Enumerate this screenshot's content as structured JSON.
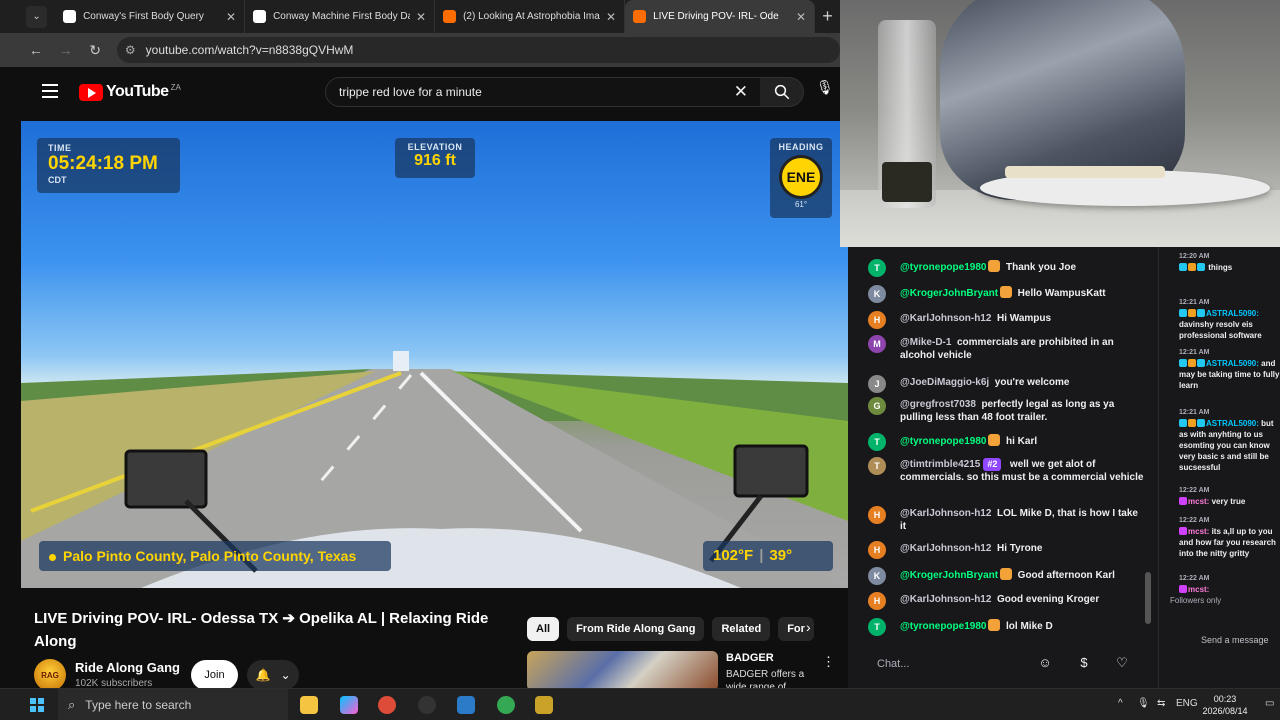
{
  "browser": {
    "tabs": [
      {
        "label": "Conway's First Body Query",
        "favicon_color": "#ffffff"
      },
      {
        "label": "Conway Machine First Body Da",
        "favicon_color": "#ffffff"
      },
      {
        "label": "(2) Looking At Astrophobia Ima",
        "favicon_color": "#ff6d00"
      },
      {
        "label": "LIVE Driving POV- IRL- Ode",
        "favicon_color": "#ff6d00"
      }
    ],
    "url": "youtube.com/watch?v=n8838gQVHwM"
  },
  "youtube": {
    "logo_text": "YouTube",
    "country": "ZA",
    "search_value": "trippe red love for a minute"
  },
  "video_overlay": {
    "time_label": "TIME",
    "time_value": "05:24:18 PM",
    "timezone": "CDT",
    "elevation_label": "ELEVATION",
    "elevation_value": "916 ft",
    "heading_label": "HEADING",
    "heading_value": "ENE",
    "heading_degrees": "61°",
    "location": "Palo Pinto County, Palo Pinto County, Texas",
    "temp_f": "102°F",
    "temp_c": "39°"
  },
  "video": {
    "title": "LIVE Driving POV- IRL- Odessa TX ➔ Opelika AL | Relaxing Ride Along",
    "channel": "Ride Along Gang",
    "subscribers": "102K subscribers",
    "join_label": "Join"
  },
  "chips": [
    "All",
    "From Ride Along Gang",
    "Related",
    "For"
  ],
  "recommendation": {
    "title": "BADGER",
    "desc": "BADGER offers a wide range of"
  },
  "chat": {
    "messages": [
      {
        "user": "@tyronepope1980",
        "text": "Thank you Joe",
        "initial": "T",
        "av": "#00b36b",
        "ucls": "green",
        "emote": true
      },
      {
        "user": "@KrogerJohnBryant",
        "text": "Hello WampusKatt",
        "initial": "K",
        "av": "#7d8aa0",
        "ucls": "green",
        "emote": true
      },
      {
        "user": "@KarlJohnson-h12",
        "text": "Hi Wampus",
        "initial": "H",
        "av": "#e67e22",
        "ucls": "gray",
        "emote": false
      },
      {
        "user": "@Mike-D-1",
        "text": "commercials are prohibited in an alcohol vehicle",
        "initial": "M",
        "av": "#8e44ad",
        "ucls": "gray",
        "emote": false
      },
      {
        "user": "@JoeDiMaggio-k6j",
        "text": "you're welcome",
        "initial": "J",
        "av": "#888888",
        "ucls": "gray",
        "emote": false
      },
      {
        "user": "@gregfrost7038",
        "text": "perfectly legal as long as ya pulling less than 48 foot trailer.",
        "initial": "G",
        "av": "#6e8b3d",
        "ucls": "gray",
        "emote": false
      },
      {
        "user": "@tyronepope1980",
        "text": "hi Karl",
        "initial": "T",
        "av": "#00b36b",
        "ucls": "green",
        "emote": true
      },
      {
        "user": "@timtrimble4215",
        "text": "well we get alot of commercials. so this must be a commercial vehicle",
        "initial": "T",
        "av": "#b08d57",
        "ucls": "gray",
        "emote": false,
        "badge": "#2"
      },
      {
        "user": "@KarlJohnson-h12",
        "text": "LOL Mike D, that is how I take it",
        "initial": "H",
        "av": "#e67e22",
        "ucls": "gray",
        "emote": false
      },
      {
        "user": "@KarlJohnson-h12",
        "text": "Hi Tyrone",
        "initial": "H",
        "av": "#e67e22",
        "ucls": "gray",
        "emote": false
      },
      {
        "user": "@KrogerJohnBryant",
        "text": "Good afternoon Karl",
        "initial": "K",
        "av": "#7d8aa0",
        "ucls": "green",
        "emote": true
      },
      {
        "user": "@KarlJohnson-h12",
        "text": "Good evening Kroger",
        "initial": "H",
        "av": "#e67e22",
        "ucls": "gray",
        "emote": false
      },
      {
        "user": "@tyronepope1980",
        "text": "lol Mike D",
        "initial": "T",
        "av": "#00b36b",
        "ucls": "green",
        "emote": true
      }
    ],
    "input_placeholder": "Chat..."
  },
  "side_chat": {
    "messages": [
      {
        "time": "12:20 AM",
        "user": "",
        "text": "things",
        "mod": false
      },
      {
        "time": "12:21 AM",
        "user": "ASTRAL5090:",
        "text": "davinshy resolv eis professional software",
        "mod": false
      },
      {
        "time": "12:21 AM",
        "user": "ASTRAL5090:",
        "text": "and may be taking time to fully learn",
        "mod": false
      },
      {
        "time": "12:21 AM",
        "user": "ASTRAL5090:",
        "text": "but as with anyhting to us esomting you can know very basic s and still be sucsessful",
        "mod": false
      },
      {
        "time": "12:22 AM",
        "user": "mcst:",
        "text": "very true",
        "mod": true
      },
      {
        "time": "12:22 AM",
        "user": "mcst:",
        "text": "its a,ll up to you and how far you research into the nitty gritty",
        "mod": true
      },
      {
        "time": "12:22 AM",
        "user": "mcst:",
        "text": "",
        "mod": true
      }
    ],
    "followers_only": "Followers only",
    "send_placeholder": "Send a message"
  },
  "taskbar": {
    "search_placeholder": "Type here to search",
    "lang": "ENG",
    "time": "00:23",
    "date": "2026/08/14"
  }
}
